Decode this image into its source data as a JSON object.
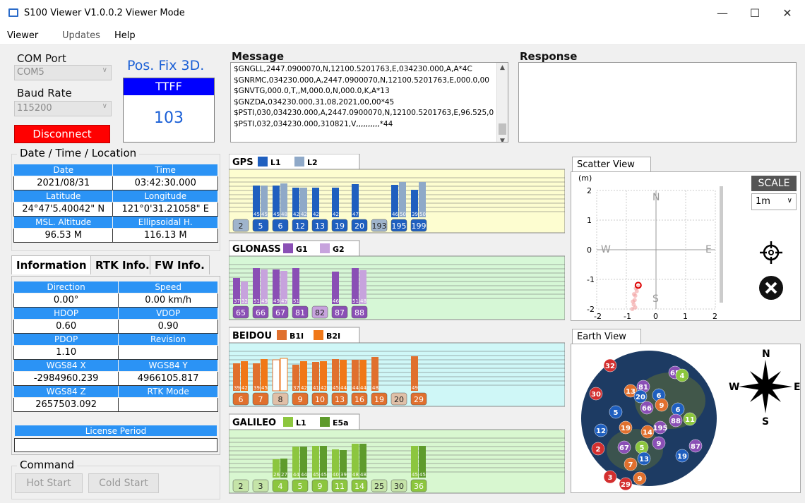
{
  "window": {
    "title": "S100 Viewer V1.0.0.2  Viewer Mode",
    "min": "—",
    "max": "☐",
    "close": "✕"
  },
  "menu": [
    "Viewer",
    "Updates",
    "Help"
  ],
  "com": {
    "label": "COM Port",
    "value": "COM5",
    "baud_label": "Baud Rate",
    "baud_value": "115200",
    "disconnect": "Disconnect"
  },
  "fix": {
    "status": "Pos. Fix 3D.",
    "ttff_label": "TTFF",
    "ttff_value": "103"
  },
  "dtl": {
    "title": "Date  / Time / Location",
    "rows": [
      [
        {
          "h": "Date",
          "v": "2021/08/31"
        },
        {
          "h": "Time",
          "v": "03:42:30.000"
        }
      ],
      [
        {
          "h": "Latitude",
          "v": "24°47'5.40042\" N"
        },
        {
          "h": "Longitude",
          "v": "121°0'31.21058\" E"
        }
      ],
      [
        {
          "h": "MSL. Altitude",
          "v": "96.53 M"
        },
        {
          "h": "Ellipsoidal H.",
          "v": "116.13 M"
        }
      ]
    ]
  },
  "tabs": [
    "Information",
    "RTK Info.",
    "FW Info."
  ],
  "info": {
    "rows": [
      [
        {
          "h": "Direction",
          "v": "0.00°"
        },
        {
          "h": "Speed",
          "v": "0.00 km/h"
        }
      ],
      [
        {
          "h": "HDOP",
          "v": "0.60"
        },
        {
          "h": "VDOP",
          "v": "0.90"
        }
      ],
      [
        {
          "h": "PDOP",
          "v": "1.10"
        },
        {
          "h": "Revision",
          "v": ""
        }
      ],
      [
        {
          "h": "WGS84 X",
          "v": "-2984960.239"
        },
        {
          "h": "WGS84 Y",
          "v": "4966105.817"
        }
      ],
      [
        {
          "h": "WGS84 Z",
          "v": "2657503.092"
        },
        {
          "h": "RTK Mode",
          "v": ""
        }
      ]
    ],
    "license_label": "License Period",
    "license_value": ""
  },
  "command": {
    "title": "Command",
    "hot": "Hot Start",
    "cold": "Cold Start"
  },
  "message": {
    "label": "Message",
    "lines": [
      "$GNGLL,2447.0900070,N,12100.5201763,E,034230.000,A,A*4C",
      "$GNRMC,034230.000,A,2447.0900070,N,12100.5201763,E,000.0,00",
      "$GNVTG,000.0,T,,M,000.0,N,000.0,K,A*13",
      "$GNZDA,034230.000,31,08,2021,00,00*45",
      "$PSTI,030,034230.000,A,2447.0900070,N,12100.5201763,E,96.525,0",
      "$PSTI,032,034230.000,310821,V,,,,,,,,,,*44"
    ]
  },
  "response": {
    "label": "Response"
  },
  "chart_data": [
    {
      "type": "bar",
      "title": "GPS",
      "legend": [
        {
          "name": "L1",
          "color": "#1f5fbf"
        },
        {
          "name": "L2",
          "color": "#8fa9c8"
        }
      ],
      "categories": [
        "2",
        "5",
        "6",
        "12",
        "13",
        "19",
        "20",
        "193",
        "195",
        "199"
      ],
      "used": [
        false,
        true,
        true,
        true,
        true,
        true,
        true,
        false,
        true,
        true
      ],
      "series": [
        {
          "name": "L1",
          "values": [
            0,
            45,
            45,
            42,
            42,
            42,
            47,
            0,
            46,
            39
          ]
        },
        {
          "name": "L2",
          "values": [
            0,
            45,
            48,
            42,
            0,
            0,
            0,
            0,
            50,
            50
          ]
        }
      ],
      "ylim": [
        0,
        60
      ],
      "bg": "#fdfdd0",
      "badge_used": "#1f5fbf",
      "badge_unused": "#9fb4cc"
    },
    {
      "type": "bar",
      "title": "GLONASS",
      "legend": [
        {
          "name": "G1",
          "color": "#8a4fb5"
        },
        {
          "name": "G2",
          "color": "#c7a3dd"
        }
      ],
      "categories": [
        "65",
        "66",
        "67",
        "81",
        "82",
        "87",
        "88"
      ],
      "used": [
        true,
        true,
        true,
        true,
        false,
        true,
        true
      ],
      "series": [
        {
          "name": "G1",
          "values": [
            37,
            51,
            49,
            51,
            0,
            46,
            51
          ]
        },
        {
          "name": "G2",
          "values": [
            32,
            49,
            47,
            0,
            0,
            0,
            48
          ]
        }
      ],
      "ylim": [
        0,
        60
      ],
      "bg": "#d6f7d6",
      "badge_used": "#8a4fb5",
      "badge_unused": "#c7a3dd"
    },
    {
      "type": "bar",
      "title": "BEIDOU",
      "legend": [
        {
          "name": "B1I",
          "color": "#e0702e"
        },
        {
          "name": "B2I",
          "color": "#f07818"
        }
      ],
      "categories": [
        "6",
        "7",
        "8",
        "9",
        "10",
        "13",
        "16",
        "19",
        "20",
        "29"
      ],
      "used": [
        true,
        true,
        false,
        true,
        true,
        true,
        true,
        true,
        false,
        true
      ],
      "series": [
        {
          "name": "B1I",
          "values": [
            39,
            39,
            44,
            37,
            41,
            45,
            44,
            48,
            0,
            49
          ]
        },
        {
          "name": "B2I",
          "values": [
            42,
            45,
            46,
            42,
            42,
            44,
            44,
            0,
            0,
            0
          ]
        }
      ],
      "ylim": [
        0,
        60
      ],
      "bg": "#cff7f7",
      "badge_used": "#e0702e",
      "badge_unused": "#e0c0a8"
    },
    {
      "type": "bar",
      "title": "GALILEO",
      "legend": [
        {
          "name": "L1",
          "color": "#8cc63e"
        },
        {
          "name": "E5a",
          "color": "#5e9b2c"
        }
      ],
      "categories": [
        "2",
        "3",
        "4",
        "5",
        "9",
        "11",
        "14",
        "25",
        "30",
        "36"
      ],
      "used": [
        false,
        false,
        true,
        true,
        true,
        true,
        true,
        false,
        false,
        true
      ],
      "series": [
        {
          "name": "L1",
          "values": [
            0,
            0,
            26,
            44,
            45,
            40,
            48,
            0,
            0,
            45
          ]
        },
        {
          "name": "E5a",
          "values": [
            0,
            0,
            27,
            44,
            45,
            39,
            48,
            0,
            0,
            45
          ]
        }
      ],
      "ylim": [
        0,
        60
      ],
      "bg": "#d8f7d0",
      "badge_used": "#8cc63e",
      "badge_unused": "#c5e4a8"
    }
  ],
  "scatter": {
    "tab": "Scatter View",
    "unit": "(m)",
    "yticks": [
      "2",
      "1",
      "0",
      "-1",
      "-2"
    ],
    "xticks": [
      "-2",
      "-1",
      "0",
      "1",
      "2"
    ],
    "compass": {
      "n": "N",
      "s": "S",
      "e": "E",
      "w": "W"
    },
    "scale_label": "SCALE",
    "scale_value": "1m"
  },
  "earth": {
    "tab": "Earth View",
    "compass": {
      "n": "N",
      "s": "S",
      "e": "E",
      "w": "W"
    },
    "sats": [
      {
        "id": "32",
        "c": "#d32f2f"
      },
      {
        "id": "65",
        "c": "#8a4fb5"
      },
      {
        "id": "4",
        "c": "#8cc63e"
      },
      {
        "id": "30",
        "c": "#d32f2f"
      },
      {
        "id": "13",
        "c": "#e0702e"
      },
      {
        "id": "81",
        "c": "#8a4fb5"
      },
      {
        "id": "20",
        "c": "#1f5fbf"
      },
      {
        "id": "6",
        "c": "#1f5fbf"
      },
      {
        "id": "66",
        "c": "#8a4fb5"
      },
      {
        "id": "9",
        "c": "#e0702e"
      },
      {
        "id": "6",
        "c": "#1f5fbf"
      },
      {
        "id": "5",
        "c": "#1f5fbf"
      },
      {
        "id": "88",
        "c": "#8a4fb5"
      },
      {
        "id": "11",
        "c": "#8cc63e"
      },
      {
        "id": "12",
        "c": "#1f5fbf"
      },
      {
        "id": "19",
        "c": "#e0702e"
      },
      {
        "id": "14",
        "c": "#e0702e"
      },
      {
        "id": "195",
        "c": "#8a4fb5"
      },
      {
        "id": "2",
        "c": "#d32f2f"
      },
      {
        "id": "67",
        "c": "#8a4fb5"
      },
      {
        "id": "5",
        "c": "#8cc63e"
      },
      {
        "id": "9",
        "c": "#8a4fb5"
      },
      {
        "id": "87",
        "c": "#8a4fb5"
      },
      {
        "id": "13",
        "c": "#1f5fbf"
      },
      {
        "id": "19",
        "c": "#1f5fbf"
      },
      {
        "id": "7",
        "c": "#e0702e"
      },
      {
        "id": "3",
        "c": "#d32f2f"
      },
      {
        "id": "29",
        "c": "#d32f2f"
      },
      {
        "id": "9",
        "c": "#e0702e"
      }
    ]
  }
}
